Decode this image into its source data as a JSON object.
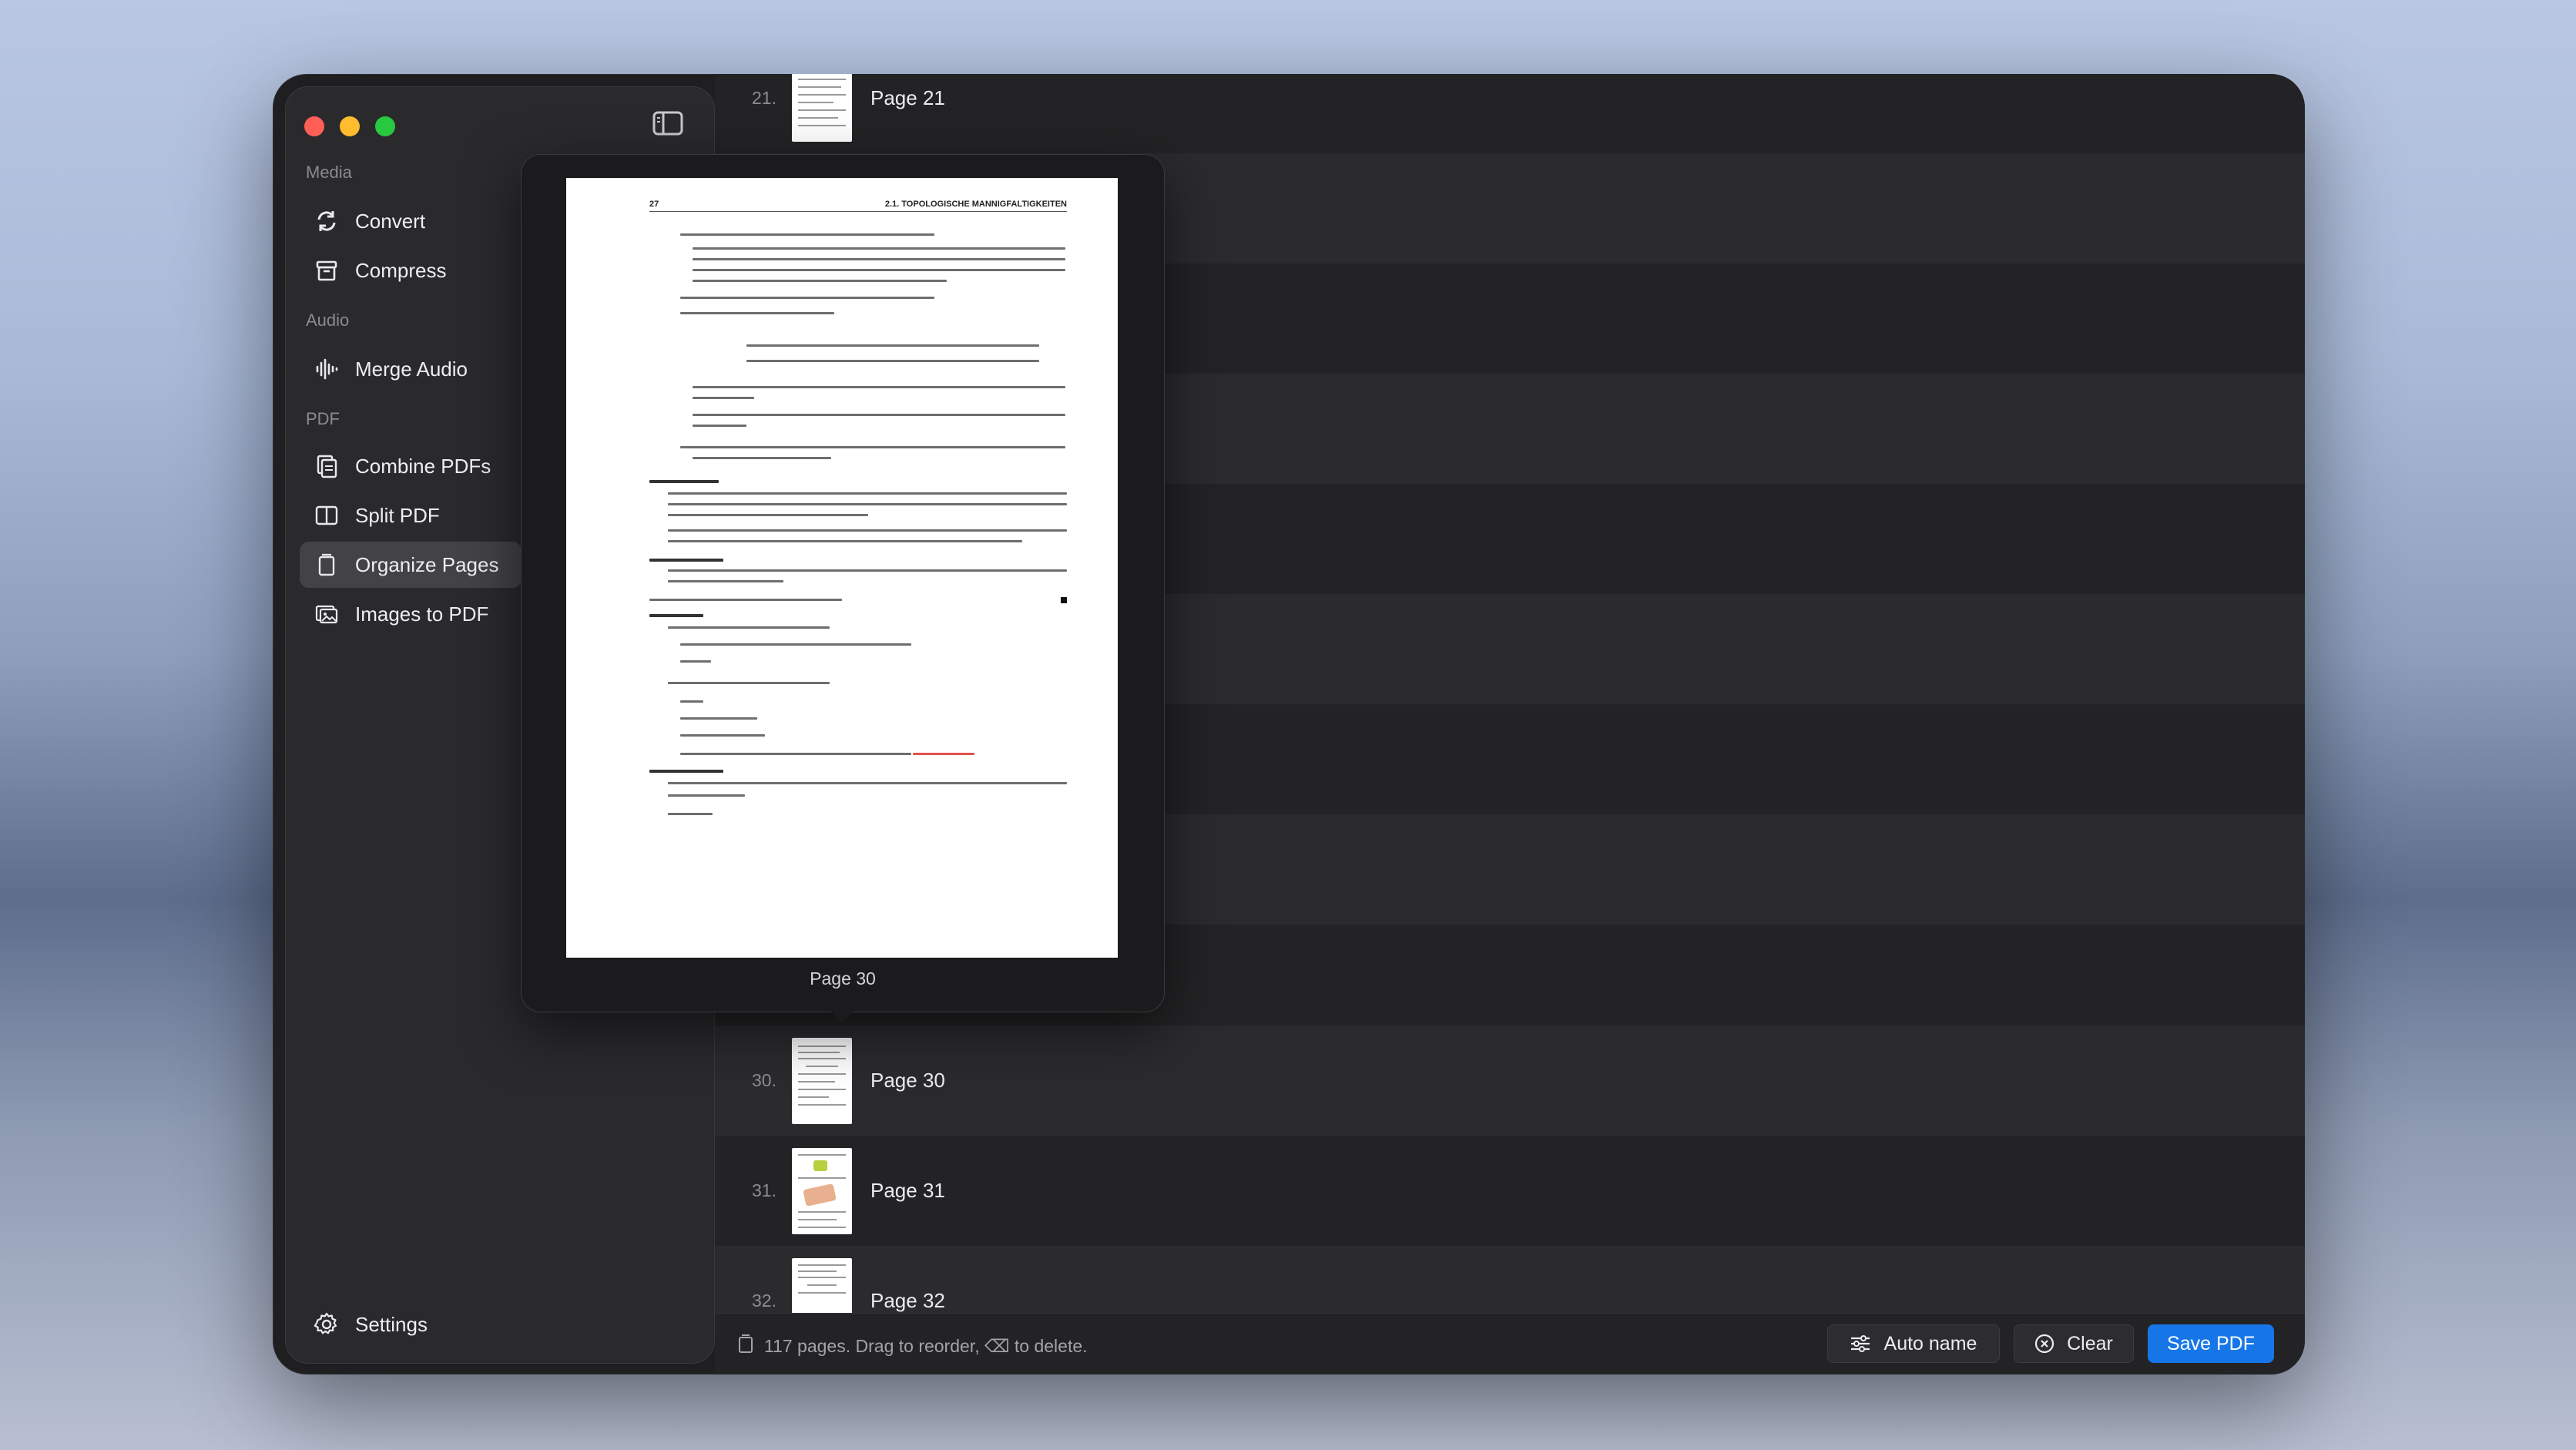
{
  "sidebar": {
    "sections": {
      "media": "Media",
      "audio": "Audio",
      "pdf": "PDF"
    },
    "items": [
      {
        "label": "Convert",
        "icon": "convert-icon"
      },
      {
        "label": "Compress",
        "icon": "compress-icon"
      },
      {
        "label": "Merge Audio",
        "icon": "waveform-icon"
      },
      {
        "label": "Combine PDFs",
        "icon": "combine-pdf-icon"
      },
      {
        "label": "Split PDF",
        "icon": "split-pdf-icon"
      },
      {
        "label": "Organize Pages",
        "icon": "organize-pages-icon",
        "selected": true
      },
      {
        "label": "Images to PDF",
        "icon": "images-icon"
      }
    ],
    "settings_label": "Settings"
  },
  "pages": [
    {
      "number": "21.",
      "label": "Page 21"
    },
    {
      "number": "30.",
      "label": "Page 30"
    },
    {
      "number": "31.",
      "label": "Page 31"
    },
    {
      "number": "32.",
      "label": "Page 32"
    }
  ],
  "preview": {
    "caption": "Page 30",
    "page_number": "27",
    "running_head": "2.1. TOPOLOGISCHE MANNIGFALTIGKEITEN"
  },
  "bottombar": {
    "status": "117 pages. Drag to reorder, ⌫ to delete.",
    "auto_name_label": "Auto name",
    "clear_label": "Clear",
    "save_label": "Save PDF"
  },
  "colors": {
    "accent": "#1676e8",
    "traffic_red": "#ff5f57",
    "traffic_yellow": "#febc2e",
    "traffic_green": "#28c840"
  }
}
